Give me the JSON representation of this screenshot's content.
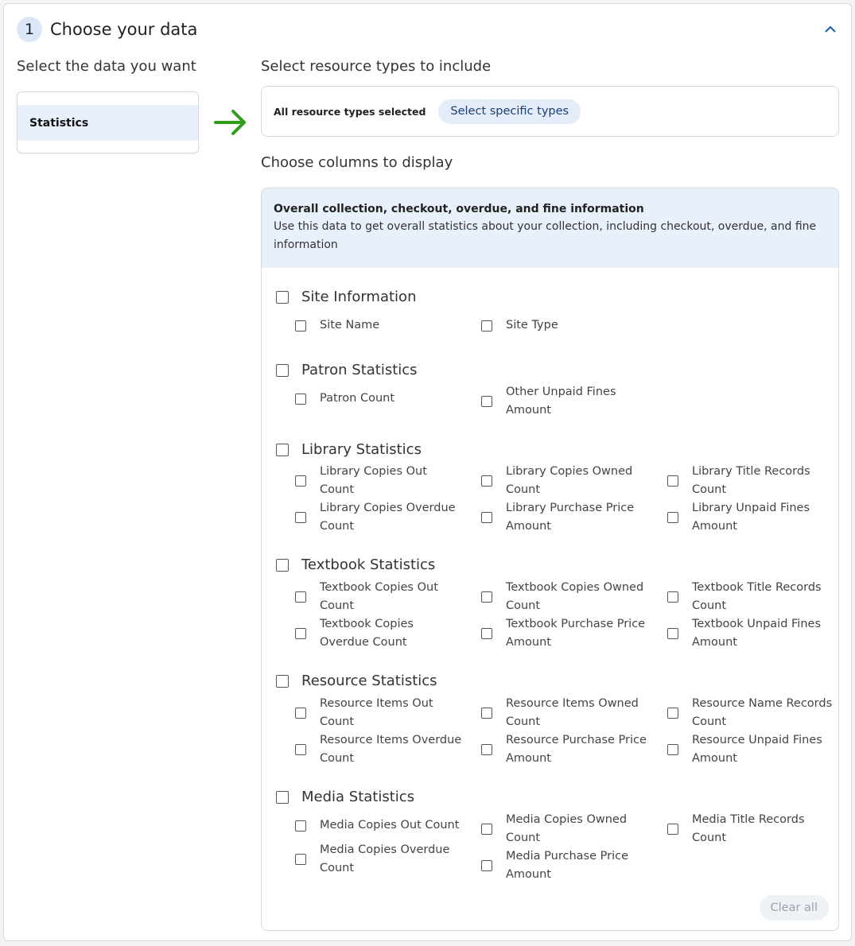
{
  "step": {
    "number": "1",
    "title": "Choose your data"
  },
  "left": {
    "heading": "Select the data you want",
    "items": [
      {
        "label": "Statistics",
        "selected": true
      }
    ]
  },
  "resource_types": {
    "heading": "Select resource types to include",
    "status": "All resource types selected",
    "button": "Select specific types"
  },
  "columns": {
    "heading": "Choose columns to display",
    "banner_title": "Overall collection, checkout, overdue, and fine information",
    "banner_desc": "Use this data to get overall statistics about your collection, including checkout, overdue, and fine information",
    "groups": [
      {
        "label": "Site Information",
        "options": [
          "Site Name",
          "Site Type"
        ]
      },
      {
        "label": "Patron Statistics",
        "options": [
          "Patron Count",
          "Other Unpaid Fines Amount"
        ]
      },
      {
        "label": "Library Statistics",
        "options": [
          "Library Copies Out Count",
          "Library Copies Owned Count",
          "Library Title Records Count",
          "Library Copies Overdue Count",
          "Library Purchase Price Amount",
          "Library Unpaid Fines Amount"
        ]
      },
      {
        "label": "Textbook Statistics",
        "options": [
          "Textbook Copies Out Count",
          "Textbook Copies Owned Count",
          "Textbook Title Records Count",
          "Textbook Copies Overdue Count",
          "Textbook Purchase Price Amount",
          "Textbook Unpaid Fines Amount"
        ]
      },
      {
        "label": "Resource Statistics",
        "options": [
          "Resource Items Out Count",
          "Resource Items Owned Count",
          "Resource Name Records Count",
          "Resource Items Overdue Count",
          "Resource Purchase Price Amount",
          "Resource Unpaid Fines Amount"
        ]
      },
      {
        "label": "Media Statistics",
        "options": [
          "Media Copies Out Count",
          "Media Copies Owned Count",
          "Media Title Records Count",
          "Media Copies Overdue Count",
          "Media Purchase Price Amount"
        ]
      }
    ],
    "clear_all": "Clear all"
  },
  "colors": {
    "accent": "#1a5fb4",
    "arrow": "#2e9e1a",
    "selected_bg": "#e8f0fb"
  },
  "icons": {
    "collapse": "chevron-up-icon",
    "arrow": "arrow-right-icon"
  }
}
